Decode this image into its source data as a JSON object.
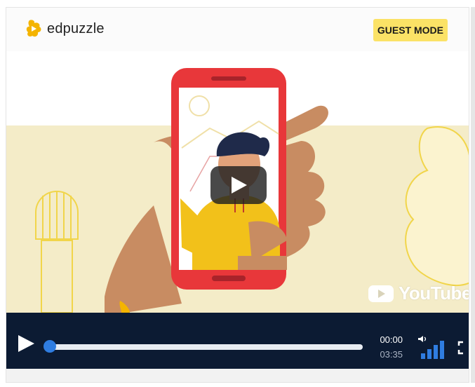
{
  "header": {
    "logo_text": "edpuzzle",
    "guest_mode_label": "GUEST MODE"
  },
  "video": {
    "watermark_text": "YouTube",
    "scene_icons": [
      "phone-illustration",
      "hand-illustration",
      "character-illustration"
    ]
  },
  "player": {
    "current_time": "00:00",
    "total_time": "03:35",
    "progress": 0,
    "volume_level": 4,
    "icons": [
      "play-icon",
      "volume-icon",
      "fullscreen-icon"
    ]
  },
  "colors": {
    "brand_yellow": "#fbe266",
    "control_bar": "#0c1b33",
    "progress_blue": "#2f7de1",
    "phone_red": "#e8373a",
    "skin": "#c88c62",
    "sweater": "#f2c11a"
  }
}
